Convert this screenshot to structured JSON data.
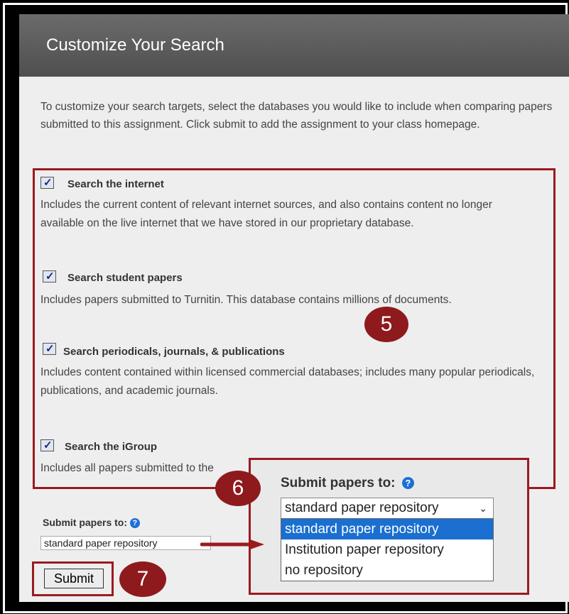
{
  "page": {
    "title": "Customize Your Search",
    "intro": "To customize your search targets, select the databases you would like to include when comparing papers submitted to this assignment. Click submit to add the assignment to your class homepage."
  },
  "options": [
    {
      "label": "Search the internet",
      "desc": "Includes the current content of relevant internet sources, and also contains content no longer available on the live internet that we have stored in our proprietary database.",
      "checked": true
    },
    {
      "label": "Search student papers",
      "desc": "Includes papers submitted to Turnitin. This database contains millions of documents.",
      "checked": true
    },
    {
      "label": "Search periodicals, journals, & publications",
      "desc": "Includes content contained within licensed commercial databases; includes many popular periodicals, publications, and academic journals.",
      "checked": true
    },
    {
      "label": "Search the iGroup",
      "desc": "Includes all papers submitted to the",
      "checked": true
    }
  ],
  "submit_papers": {
    "label": "Submit papers to:",
    "help_icon": "?",
    "selected": "standard paper repository",
    "options": [
      "standard paper repository",
      "Institution paper repository",
      "no repository"
    ]
  },
  "submit_button": "Submit",
  "badges": [
    "5",
    "6",
    "7"
  ],
  "colors": {
    "annotation_red": "#9a1b1f",
    "selection_blue": "#1a6fd0",
    "header_gray": "#5e5e5e"
  }
}
